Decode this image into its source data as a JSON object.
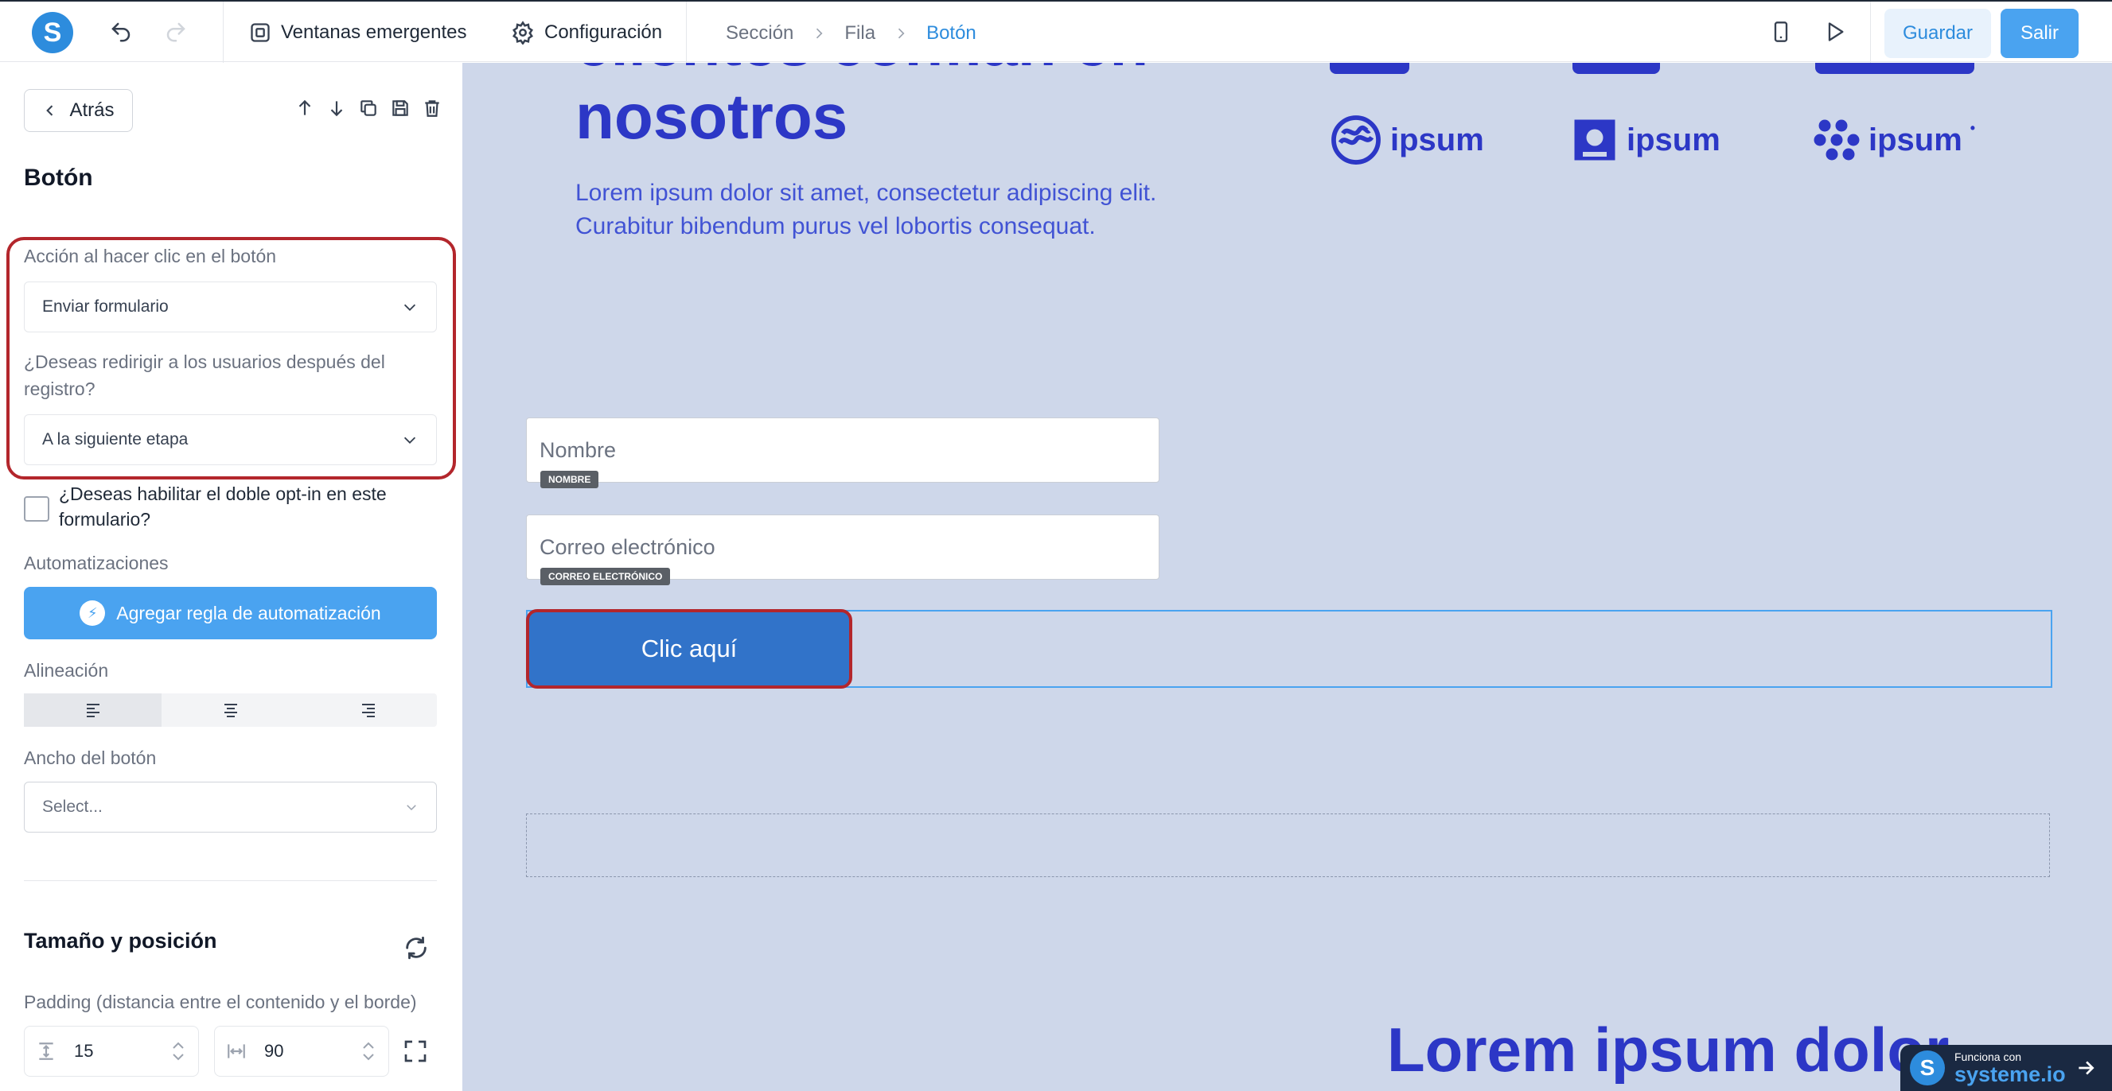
{
  "topbar": {
    "logo_letter": "S",
    "popups_label": "Ventanas emergentes",
    "settings_label": "Configuración",
    "breadcrumbs": [
      "Sección",
      "Fila",
      "Botón"
    ],
    "save_label": "Guardar",
    "exit_label": "Salir"
  },
  "sidebar": {
    "back_label": "Atrás",
    "title": "Botón",
    "click_action_label": "Acción al hacer clic en el botón",
    "click_action_value": "Enviar formulario",
    "redirect_label": "¿Deseas redirigir a los usuarios después del registro?",
    "redirect_value": "A la siguiente etapa",
    "double_optin_label": "¿Deseas habilitar el doble opt-in en este formulario?",
    "double_optin_checked": false,
    "automations_label": "Automatizaciones",
    "add_rule_label": "Agregar regla de automatización",
    "alignment_label": "Alineación",
    "alignment_selected": "left",
    "button_width_label": "Ancho del botón",
    "button_width_placeholder": "Select...",
    "size_position_title": "Tamaño y posición",
    "padding_label": "Padding (distancia entre el contenido y el borde)",
    "padding_vertical": "15",
    "padding_horizontal": "90"
  },
  "canvas": {
    "heading_line1": "clientes confían en",
    "heading_line2": "nosotros",
    "paragraph": "Lorem ipsum dolor sit amet, consectetur adipiscing elit. Curabitur bibendum purus vel lobortis consequat.",
    "logo_text": "ipsum",
    "name_placeholder": "Nombre",
    "name_tag": "NOMBRE",
    "email_placeholder": "Correo electrónico",
    "email_tag": "CORREO ELECTRÓNICO",
    "cta_label": "Clic aquí",
    "bottom_heading": "Lorem ipsum dolor",
    "badge_small": "Funciona con",
    "badge_big": "systeme.io"
  },
  "colors": {
    "accent": "#2d8cdd",
    "primary_button": "#4aa3f0",
    "highlight": "#b3262c",
    "canvas_bg": "#ced7ea",
    "heading": "#2c37c6",
    "cta": "#3173c9"
  }
}
